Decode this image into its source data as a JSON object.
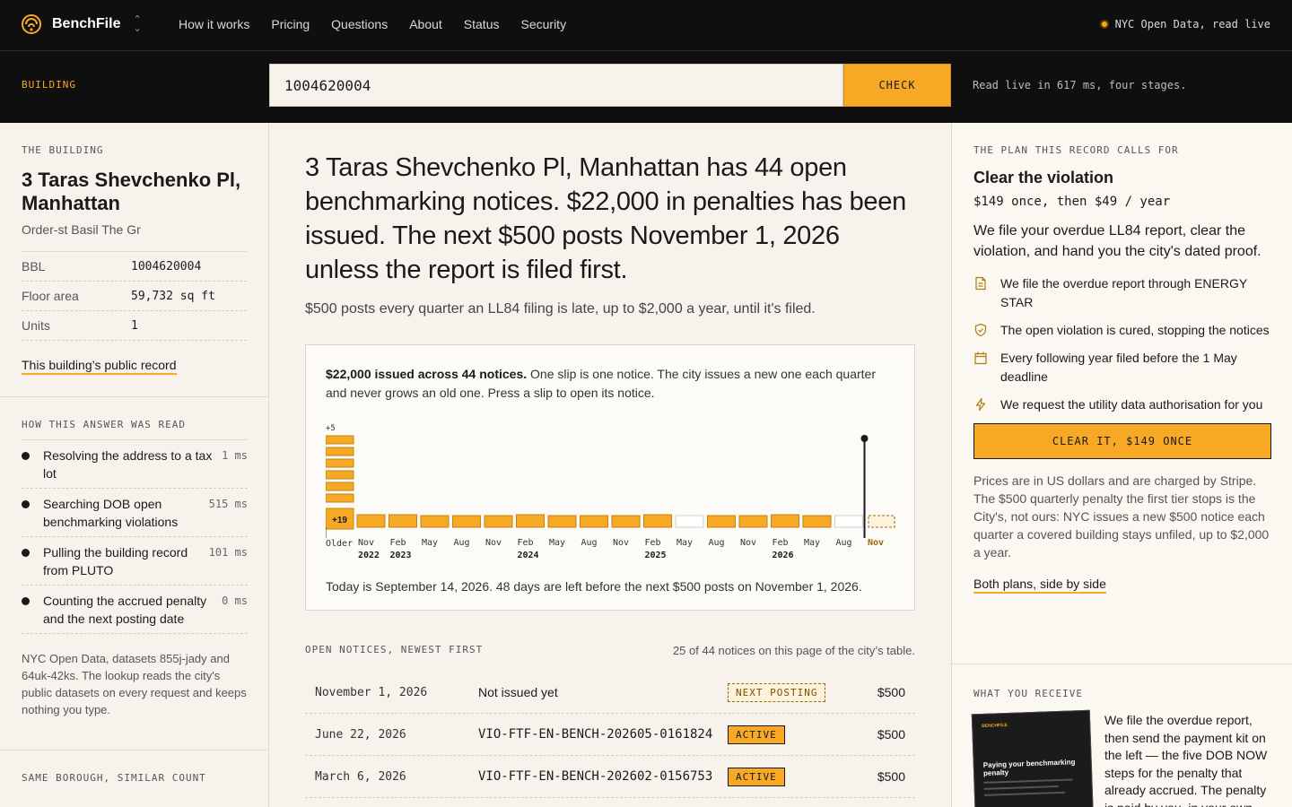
{
  "nav": {
    "brand": "BenchFile",
    "links": [
      "How it works",
      "Pricing",
      "Questions",
      "About",
      "Status",
      "Security"
    ],
    "live_status": "NYC Open Data, read live",
    "accent": "#f7a925"
  },
  "search": {
    "label": "BUILDING",
    "value": "1004620004",
    "button": "CHECK",
    "note": "Read live in 617 ms, four stages."
  },
  "building": {
    "section": "THE BUILDING",
    "name": "3 Taras Shevchenko Pl, Manhattan",
    "owner": "Order-st Basil The Gr",
    "fields": [
      {
        "k": "BBL",
        "v": "1004620004"
      },
      {
        "k": "Floor area",
        "v": "59,732 sq ft"
      },
      {
        "k": "Units",
        "v": "1"
      }
    ],
    "record_link": "This building’s public record"
  },
  "how": {
    "section": "HOW THIS ANSWER WAS READ",
    "steps": [
      {
        "text": "Resolving the address to a tax lot",
        "ms": "1 ms"
      },
      {
        "text": "Searching DOB open benchmarking violations",
        "ms": "515 ms"
      },
      {
        "text": "Pulling the building record from PLUTO",
        "ms": "101 ms"
      },
      {
        "text": "Counting the accrued penalty and the next posting date",
        "ms": "0 ms"
      }
    ],
    "note": "NYC Open Data, datasets 855j-jady and 64uk-42ks. The lookup reads the city's public datasets on every request and keeps nothing you type."
  },
  "same": {
    "section": "SAME BOROUGH, SIMILAR COUNT"
  },
  "main": {
    "headline": "3 Taras Shevchenko Pl, Manhattan has 44 open benchmarking notices. $22,000 in penalties has been issued. The next $500 posts November 1, 2026 unless the report is filed first.",
    "subline": "$500 posts every quarter an LL84 filing is late, up to $2,000 a year, until it's filed.",
    "card_bold": "$22,000 issued across 44 notices.",
    "card_text": " One slip is one notice. The city issues a new one each quarter and never grows an old one. Press a slip to open its notice.",
    "card_footer": "Today is September 14, 2026. 48 days are left before the next $500 posts on November 1, 2026."
  },
  "chart_data": {
    "type": "bar",
    "older_stack_plus": "+5",
    "older_badge": "+19",
    "older_label": "Older",
    "categories": [
      "Nov",
      "Feb",
      "May",
      "Aug",
      "Nov",
      "Feb",
      "May",
      "Aug",
      "Nov",
      "Feb",
      "May",
      "Aug",
      "Nov",
      "Feb",
      "May",
      "Aug",
      "Nov"
    ],
    "years": [
      "2022",
      "2023",
      "",
      "",
      "",
      "2024",
      "",
      "",
      "",
      "2025",
      "",
      "",
      "",
      "2026",
      "",
      "",
      ""
    ],
    "slips": [
      1,
      1,
      1,
      1,
      1,
      1,
      1,
      1,
      1,
      1,
      0,
      1,
      1,
      1,
      1,
      0,
      1
    ],
    "state": [
      "filled",
      "filled",
      "filled",
      "filled",
      "filled",
      "filled",
      "filled",
      "filled",
      "filled",
      "filled",
      "empty",
      "filled",
      "filled",
      "filled",
      "filled",
      "empty",
      "next"
    ],
    "today_marker": "between Aug 2026 and Nov 2026"
  },
  "notices": {
    "section": "OPEN NOTICES, NEWEST FIRST",
    "count_note": "25 of 44 notices on this page of the city’s table.",
    "rows": [
      {
        "date": "November 1, 2026",
        "id": "Not issued yet",
        "status": "NEXT POSTING",
        "amount": "$500"
      },
      {
        "date": "June 22, 2026",
        "id": "VIO-FTF-EN-BENCH-202605-0161824",
        "status": "ACTIVE",
        "amount": "$500"
      },
      {
        "date": "March 6, 2026",
        "id": "VIO-FTF-EN-BENCH-202602-0156753",
        "status": "ACTIVE",
        "amount": "$500"
      }
    ]
  },
  "plan": {
    "section": "THE PLAN THIS RECORD CALLS FOR",
    "title": "Clear the violation",
    "price": "$149 once, then $49 / year",
    "desc": "We file your overdue LL84 report, clear the violation, and hand you the city's dated proof.",
    "features": [
      {
        "icon": "document-icon",
        "text": "We file the overdue report through ENERGY STAR"
      },
      {
        "icon": "shield-check-icon",
        "text": "The open violation is cured, stopping the notices"
      },
      {
        "icon": "calendar-icon",
        "text": "Every following year filed before the 1 May deadline"
      },
      {
        "icon": "lightning-icon",
        "text": "We request the utility data authorisation for you"
      }
    ],
    "cta": "CLEAR IT, $149 ONCE",
    "fine": "Prices are in US dollars and are charged by Stripe. The $500 quarterly penalty the first tier stops is the City's, not ours: NYC issues a new $500 notice each quarter a covered building stays unfiled, up to $2,000 a year.",
    "compare_link": "Both plans, side by side"
  },
  "receive": {
    "section": "WHAT YOU RECEIVE",
    "thumb_brand": "BENCHFILE",
    "thumb_title": "Paying your benchmarking penalty",
    "text": "We file the overdue report, then send the payment kit on the left — the five DOB NOW steps for the penalty that already accrued. The penalty is paid by you, in your own"
  }
}
